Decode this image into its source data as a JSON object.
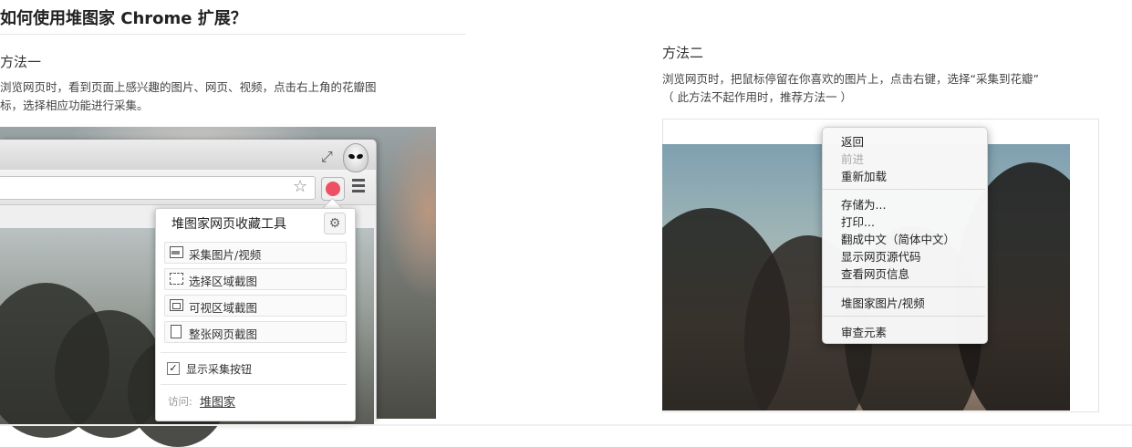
{
  "page": {
    "title": "如何使用堆图家 Chrome 扩展？"
  },
  "method1": {
    "title": "方法一",
    "desc_line1": "浏览网页时，看到页面上感兴趣的图片、网页、视频，点击右上角的花瓣图",
    "desc_line2": "标，选择相应功能进行采集。",
    "popup": {
      "title": "堆图家网页收藏工具",
      "items": [
        {
          "label": "采集图片/视频",
          "icon": "image-icon"
        },
        {
          "label": "选择区域截图",
          "icon": "select-area-icon"
        },
        {
          "label": "可视区域截图",
          "icon": "visible-area-icon"
        },
        {
          "label": "整张网页截图",
          "icon": "full-page-icon"
        }
      ],
      "checkbox_label": "显示采集按钮",
      "checkbox_checked": true,
      "visit_label": "访问:",
      "visit_link": "堆图家"
    }
  },
  "method2": {
    "title": "方法二",
    "desc_line1": "浏览网页时，把鼠标停留在你喜欢的图片上，点击右键，选择“采集到花瓣”",
    "desc_line2": "（ 此方法不起作用时，推荐方法一 ）",
    "context_menu": {
      "group1": [
        "返回",
        "前进",
        "重新加载"
      ],
      "group2": [
        "存储为...",
        "打印...",
        "翻成中文（简体中文）",
        "显示网页源代码",
        "查看网页信息"
      ],
      "group3": [
        "堆图家图片/视频"
      ],
      "group4": [
        "审查元素"
      ],
      "disabled": [
        "前进"
      ]
    }
  },
  "icons": {
    "resize": "resize-icon",
    "bookmark": "star-icon",
    "extension": "huaban-extension-icon",
    "menu": "hamburger-menu-icon",
    "settings": "gear-icon"
  },
  "colors": {
    "extension_accent": "#ef4f63"
  }
}
